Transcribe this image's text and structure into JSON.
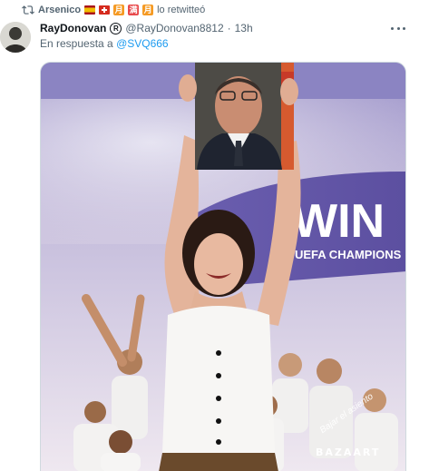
{
  "retweet": {
    "name": "Arsenico",
    "emoji_1": "月",
    "emoji_2": "满",
    "emoji_3": "月",
    "action_text": "lo retwitteó",
    "icon": "retweet-icon"
  },
  "tweet": {
    "display_name": "RayDonovan",
    "reg_mark": "R",
    "handle": "@RayDonovan8812",
    "separator": "·",
    "time": "13h",
    "reply_prefix": "En respuesta a",
    "reply_handle": "@SVQ666",
    "more_icon": "more-dots-icon"
  },
  "media": {
    "banner_text": "WIN",
    "banner_subtext": "UEFA CHAMPIONS",
    "watermark": "BAZAART",
    "scribble": "Bajar el asiento"
  },
  "colors": {
    "link": "#1d9bf0",
    "muted": "#536471",
    "banner_purple": "#6a5aa8"
  }
}
